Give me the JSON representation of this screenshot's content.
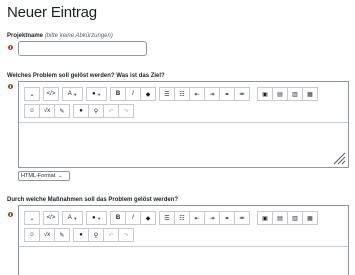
{
  "page": {
    "title": "Neuer Eintrag"
  },
  "fields": {
    "projektname": {
      "label": "Projektname",
      "hint": "(bitte keine Abkürzungen)",
      "value": ""
    },
    "problem": {
      "label": "Welches Problem soll gelöst werden? Was ist das Ziel?",
      "format": "HTML-Format"
    },
    "massnahmen": {
      "label": "Durch welche Maßnahmen soll das Problem gelöst werden?"
    }
  },
  "toolbar": {
    "paragraph_glyph": "⌄",
    "code_glyph": "</>",
    "font_glyph": "A",
    "color_glyph": "●",
    "bold": "B",
    "italic": "I",
    "clear_glyph": "◆",
    "ul_glyph": "☰",
    "ol_glyph": "☷",
    "outdent_glyph": "⇤",
    "indent_glyph": "⇥",
    "link_glyph": "⚭",
    "unlink_glyph": "⚮",
    "image_glyph": "▣",
    "media_glyph": "▤",
    "file_glyph": "▥",
    "table_glyph": "▦",
    "emoji_glyph": "☺",
    "math_glyph": "√x",
    "edit_glyph": "✎",
    "help_glyph": "●",
    "format_glyph": "⚲",
    "undo_glyph": "↶",
    "redo_glyph": "↷",
    "caret_glyph": "▼"
  }
}
